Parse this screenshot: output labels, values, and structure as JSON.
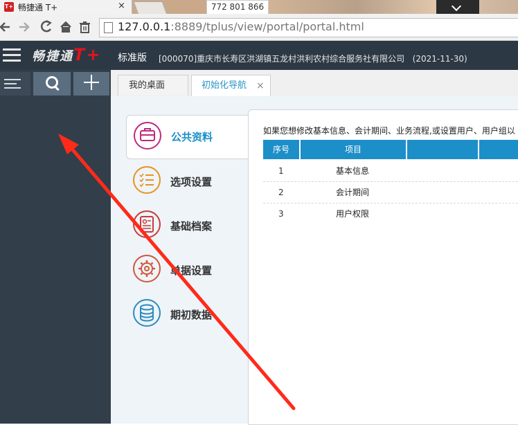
{
  "browser": {
    "tab_title": "畅捷通 T+",
    "tab_close": "×",
    "favicon_text": "T+",
    "overlay_text": "772 801 866",
    "url_host": "127.0.0.1",
    "url_rest": ":8889/tplus/view/portal/portal.html"
  },
  "header": {
    "brand": "畅捷通",
    "brand_tplus": "T+",
    "edition": "标准版",
    "company": "[000070]重庆市长寿区洪湖镇五龙村洪利农村综合服务社有限公司",
    "date": "(2021-11-30)"
  },
  "tabs": [
    {
      "label": "我的桌面"
    },
    {
      "label": "初始化导航",
      "close": "×"
    }
  ],
  "nav": [
    {
      "label": "公共资料",
      "icon": "briefcase-icon",
      "color": "#c0287d"
    },
    {
      "label": "选项设置",
      "icon": "checklist-icon",
      "color": "#e8921e"
    },
    {
      "label": "基础档案",
      "icon": "profile-card-icon",
      "color": "#c83a3a"
    },
    {
      "label": "单据设置",
      "icon": "gear-icon",
      "color": "#d2553a"
    },
    {
      "label": "期初数据",
      "icon": "database-icon",
      "color": "#2b8bc0"
    }
  ],
  "content": {
    "intro": "如果您想修改基本信息、会计期间、业务流程,或设置用户、用户组以",
    "columns": [
      "序号",
      "项目",
      "",
      ""
    ],
    "rows": [
      {
        "no": "1",
        "item": "基本信息"
      },
      {
        "no": "2",
        "item": "会计期间"
      },
      {
        "no": "3",
        "item": "用户权限"
      }
    ]
  },
  "colors": {
    "header_bg": "#2c3844",
    "sidebar_bg": "#323e4a",
    "accent": "#1d8fc8",
    "annotation": "#ff2a1a"
  }
}
